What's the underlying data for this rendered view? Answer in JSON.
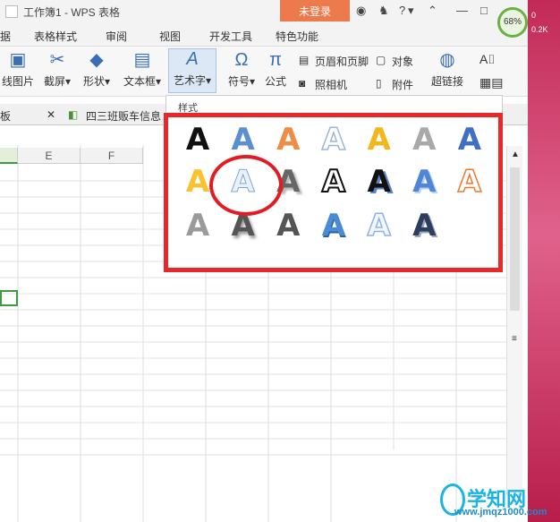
{
  "titlebar": {
    "doc_title": "工作簿1 - WPS 表格",
    "login_label": "未登录",
    "help_label": "?"
  },
  "menubar": {
    "items": [
      "据",
      "表格样式",
      "审阅",
      "视图",
      "开发工具",
      "特色功能"
    ]
  },
  "ribbon": {
    "items": [
      "线图片",
      "截屏",
      "形状",
      "文本框",
      "艺术字",
      "符号",
      "公式",
      "超链接"
    ],
    "small": [
      "页眉和页脚",
      "对象",
      "照相机",
      "附件"
    ]
  },
  "tabbar": {
    "left_label": "板",
    "tab_label": "四三班贩车信息"
  },
  "grid": {
    "columns": [
      "E",
      "F"
    ]
  },
  "status": {
    "percent": "68%",
    "up": "0",
    "down": "0.2K"
  },
  "wordart_popup": {
    "title": "样式",
    "rows": [
      [
        {
          "style": "black",
          "glyph": "A"
        },
        {
          "style": "blue-gradient",
          "glyph": "A"
        },
        {
          "style": "orange-gradient",
          "glyph": "A"
        },
        {
          "style": "blue-outline",
          "glyph": "A"
        },
        {
          "style": "gold",
          "glyph": "A"
        },
        {
          "style": "gray",
          "glyph": "A"
        },
        {
          "style": "blue-reflection",
          "glyph": "A"
        }
      ],
      [
        {
          "style": "gold-reflection",
          "glyph": "A"
        },
        {
          "style": "light-blue-outline",
          "glyph": "A"
        },
        {
          "style": "gray-shadow",
          "glyph": "A"
        },
        {
          "style": "black-outline",
          "glyph": "A"
        },
        {
          "style": "black-blue-shadow",
          "glyph": "A"
        },
        {
          "style": "blue-3d",
          "glyph": "A"
        },
        {
          "style": "orange-outline",
          "glyph": "A"
        }
      ],
      [
        {
          "style": "light-gray",
          "glyph": "A"
        },
        {
          "style": "dark-shadow",
          "glyph": "A"
        },
        {
          "style": "dark-gray",
          "glyph": "A"
        },
        {
          "style": "blue-bevel",
          "glyph": "A"
        },
        {
          "style": "pale-blue-outline",
          "glyph": "A"
        },
        {
          "style": "striped-navy",
          "glyph": "A"
        }
      ]
    ]
  },
  "watermark": {
    "title": "学知网",
    "url": "www.jmqz1000.com"
  }
}
